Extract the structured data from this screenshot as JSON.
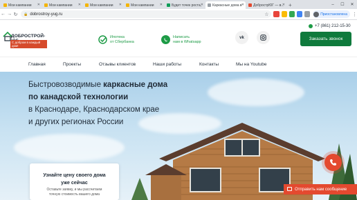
{
  "browser": {
    "tabs": [
      {
        "label": "Мои кампании",
        "fav": "#f4b400",
        "active": false
      },
      {
        "label": "Мои кампании",
        "fav": "#f4b400",
        "active": false
      },
      {
        "label": "Мои кампании",
        "fav": "#f4b400",
        "active": false
      },
      {
        "label": "Мои кампании",
        "fav": "#f4b400",
        "active": false
      },
      {
        "label": "Будет точек роста, и...",
        "fav": "#0f9d58",
        "active": false
      },
      {
        "label": "Каркасные дома в Б...",
        "fav": "#9aa0a6",
        "active": true
      },
      {
        "label": "ДобрострЮГ — в...",
        "fav": "#e4492f",
        "active": false
      }
    ],
    "url": "dobrostroy-yug.ru",
    "profile_label": "Приостановлена"
  },
  "header": {
    "logo_name": "ДОБРОСТРОЙ-ЮГ",
    "logo_tagline": "С добром в каждый дом!",
    "sber_text": [
      "Ипотека",
      "от Сбербанка"
    ],
    "whatsapp_text": [
      "Написать",
      "нам в Whatsapp"
    ],
    "vk_label": "vk",
    "phone": "+7 (861) 212-15-30",
    "call_button": "Заказать звонок"
  },
  "nav": [
    "Главная",
    "Проекты",
    "Отзывы клиентов",
    "Наши работы",
    "Контакты",
    "Мы на Youtube"
  ],
  "hero": {
    "title_line1_normal": "Быстровозводимые ",
    "title_line1_bold": "каркасные дома",
    "title_line2": "по канадской технологии",
    "title_line3": "в Краснодаре, Краснодарском крае",
    "title_line4": "и других регионах России"
  },
  "form": {
    "title": [
      "Узнайте цену своего дома",
      "уже сейчас"
    ],
    "subtitle": [
      "Оставьте заявку, и мы рассчитаем",
      "точную стоимость вашего дома"
    ]
  },
  "chat": {
    "label": "Отправить нам сообщение"
  },
  "colors": {
    "accent_green": "#0f7a3c",
    "accent_red": "#e4492f",
    "sber_green": "#1d9b46"
  }
}
